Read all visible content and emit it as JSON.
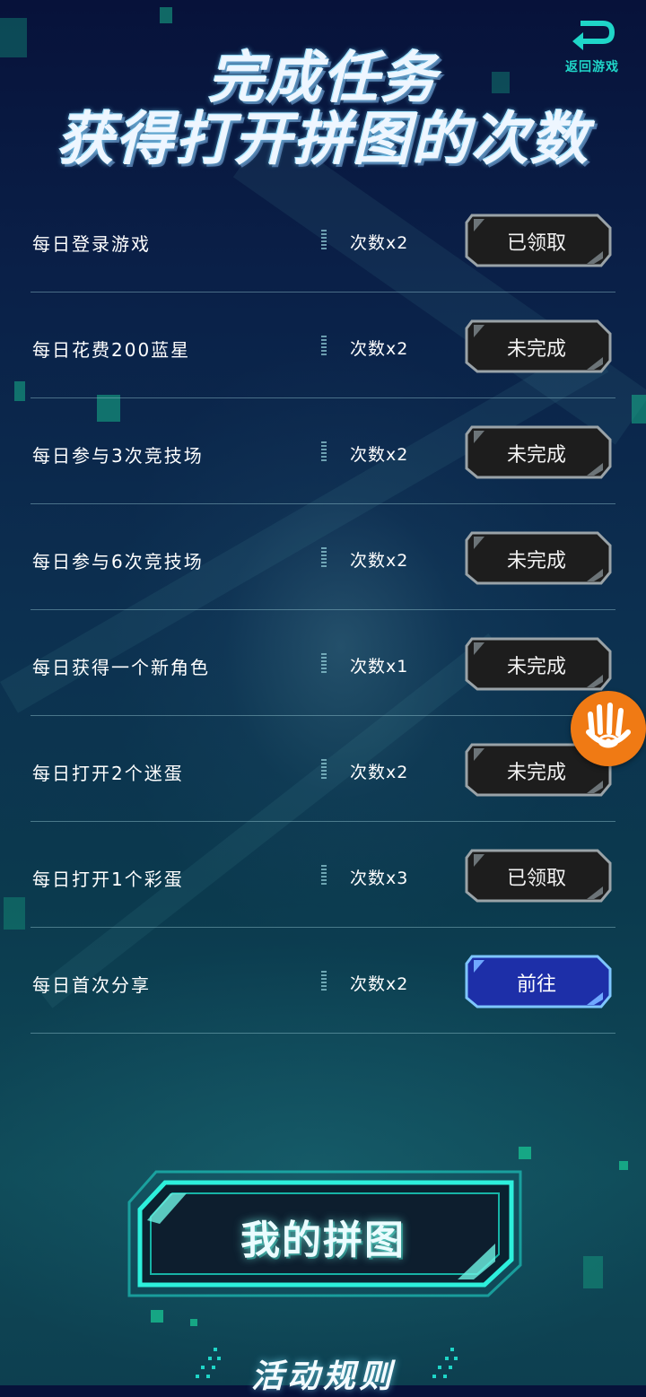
{
  "header": {
    "title_line1": "完成任务",
    "title_line2": "获得打开拼图的次数",
    "back_label": "返回游戏"
  },
  "tasks": [
    {
      "name": "每日登录游戏",
      "count": "次数x2",
      "button": "已领取",
      "state": "claimed"
    },
    {
      "name": "每日花费200蓝星",
      "count": "次数x2",
      "button": "未完成",
      "state": "incomplete"
    },
    {
      "name": "每日参与3次竞技场",
      "count": "次数x2",
      "button": "未完成",
      "state": "incomplete"
    },
    {
      "name": "每日参与6次竞技场",
      "count": "次数x2",
      "button": "未完成",
      "state": "incomplete"
    },
    {
      "name": "每日获得一个新角色",
      "count": "次数x1",
      "button": "未完成",
      "state": "incomplete"
    },
    {
      "name": "每日打开2个迷蛋",
      "count": "次数x2",
      "button": "未完成",
      "state": "incomplete"
    },
    {
      "name": "每日打开1个彩蛋",
      "count": "次数x3",
      "button": "已领取",
      "state": "claimed"
    },
    {
      "name": "每日首次分享",
      "count": "次数x2",
      "button": "前往",
      "state": "go"
    }
  ],
  "floating_button": {
    "icon": "hand-eye-icon",
    "color": "#f07a14"
  },
  "puzzle_button": {
    "label": "我的拼图"
  },
  "rules": {
    "title": "活动规则"
  },
  "colors": {
    "accent_teal": "#1fd6c8",
    "go_button_blue": "#1d2fa8",
    "row_button_dark": "#1c1c1c"
  }
}
